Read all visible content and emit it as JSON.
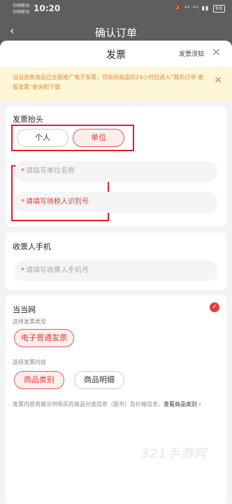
{
  "status_bar": {
    "carrier_1": "中国移动",
    "carrier_2": "中国移动",
    "time": "10:20",
    "icons_text": "🔕 ⁴⁶ ⁴ᴳ ▮▮",
    "battery": "96"
  },
  "page": {
    "back": "‹",
    "title": "确认订单"
  },
  "sheet": {
    "title": "发票",
    "notice_link": "发票须知",
    "close": "✕"
  },
  "banner": {
    "text": "当当自营商品已全面推广电子发票，可收到商品的24小时后进入“我的订单-查看发票”查询和下载",
    "close": "✕"
  },
  "invoice_header": {
    "title": "发票抬头",
    "options": [
      "个人",
      "单位"
    ],
    "selected": "单位",
    "company_name_placeholder": "请填写单位名称",
    "tax_id_placeholder": "请填写纳税人识别号",
    "required_mark": "*"
  },
  "phone": {
    "title": "收票人手机",
    "placeholder": "请填写收票人手机号",
    "required_mark": "*"
  },
  "store": {
    "name": "当当网",
    "type_label": "选择发票类型",
    "type_option": "电子普通发票",
    "content_label": "选择发票内容",
    "content_options": [
      "商品类别",
      "商品明细"
    ],
    "content_selected": "商品类别",
    "description": "发票内容将展示所购买的商品分类信息（图书）及价格信息，",
    "description_link": "查看商品类别",
    "description_arrow": "›",
    "check": "✓"
  },
  "watermark": "321手游网",
  "colors": {
    "accent": "#e0403a",
    "banner_bg": "#fdf6d7",
    "banner_text": "#e88a3c",
    "highlight_box": "#e0202a"
  }
}
